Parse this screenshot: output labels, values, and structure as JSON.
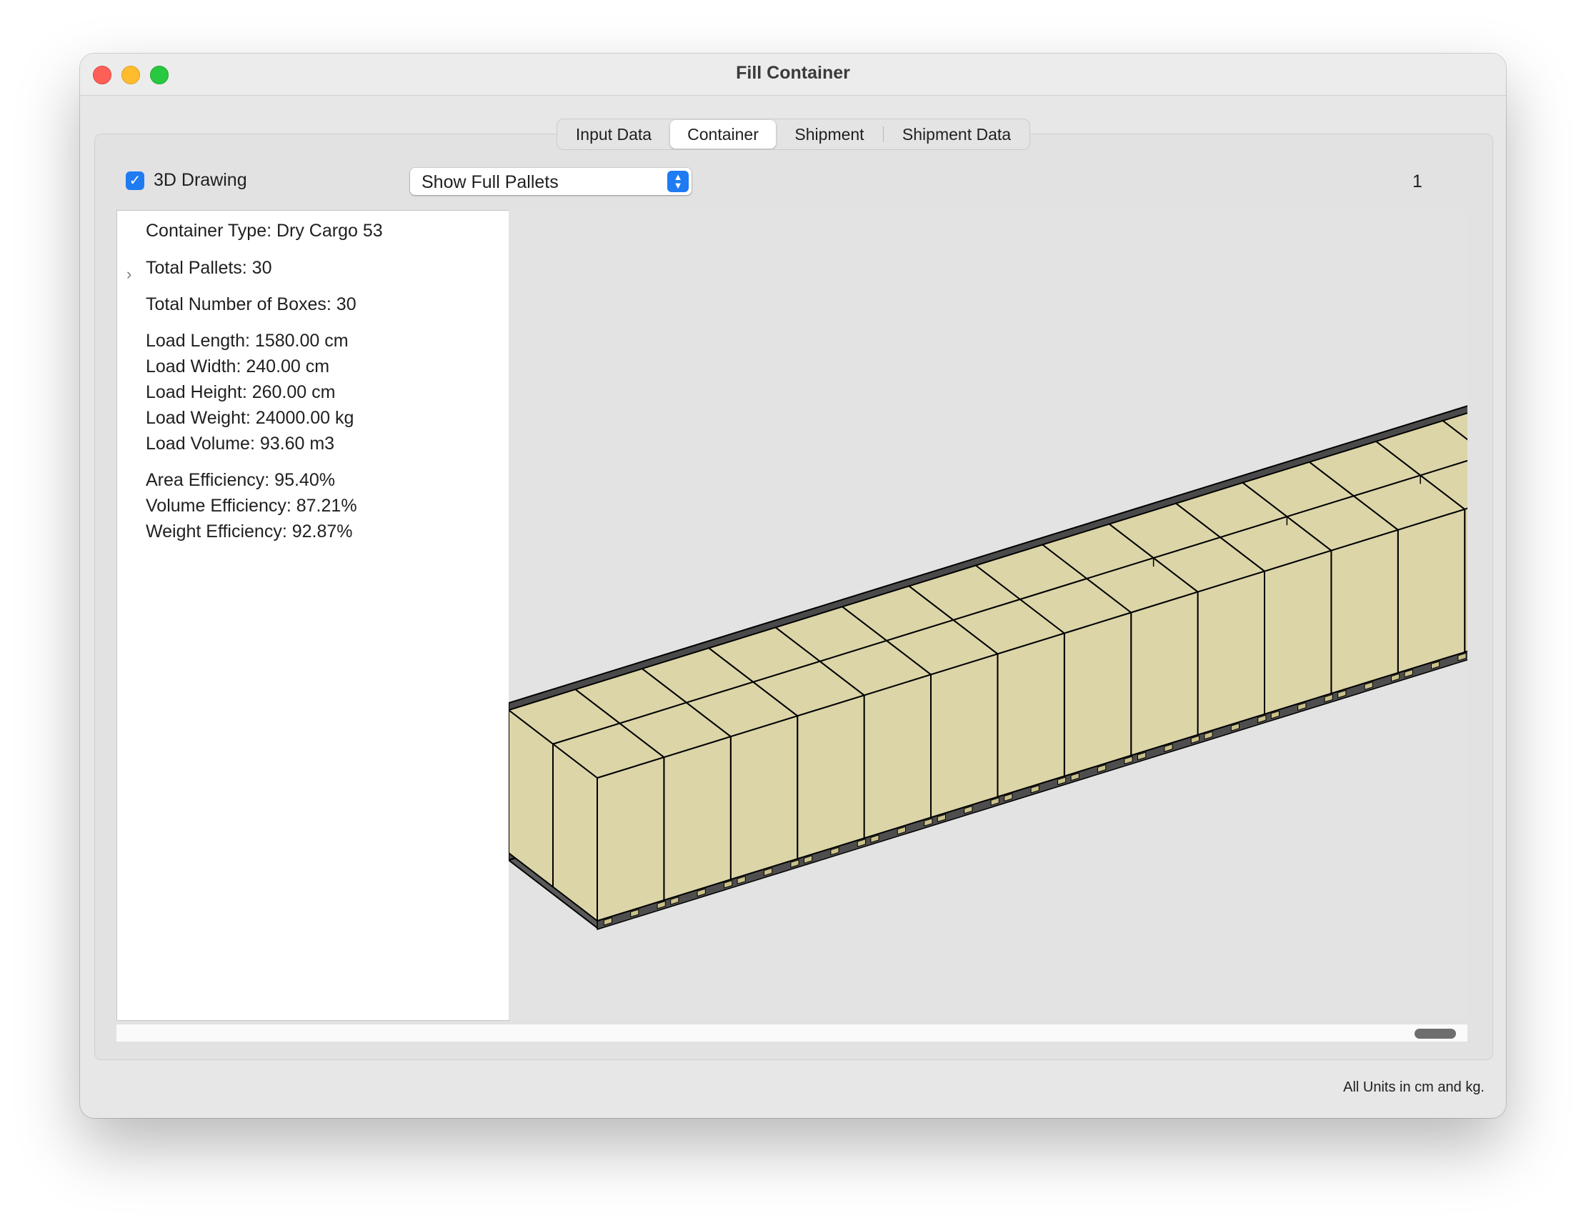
{
  "window": {
    "title": "Fill Container"
  },
  "tabs": [
    {
      "label": "Input Data",
      "active": false
    },
    {
      "label": "Container",
      "active": true
    },
    {
      "label": "Shipment",
      "active": false
    },
    {
      "label": "Shipment Data",
      "active": false
    }
  ],
  "toolbar": {
    "drawing_3d_label": "3D Drawing",
    "drawing_3d_checked": true,
    "view_select_value": "Show Full Pallets",
    "page_number": "1"
  },
  "info": {
    "container_type": "Container Type: Dry Cargo 53",
    "total_pallets": "Total Pallets: 30",
    "total_boxes": "Total Number of Boxes: 30",
    "load_length": "Load Length: 1580.00 cm",
    "load_width": "Load Width: 240.00 cm",
    "load_height": "Load Height: 260.00 cm",
    "load_weight": "Load Weight: 24000.00 kg",
    "load_volume": "Load Volume: 93.60 m3",
    "area_efficiency": "Area Efficiency: 95.40%",
    "volume_efficiency": "Volume Efficiency: 87.21%",
    "weight_efficiency": "Weight Efficiency: 92.87%"
  },
  "drawing": {
    "rows": 2,
    "columns": 15,
    "box_color": "#dcd5a8",
    "container_wall_color": "#4a4a4a",
    "pallet_color": "#c9c08a"
  },
  "footer": {
    "units_note": "All Units in cm and kg."
  }
}
